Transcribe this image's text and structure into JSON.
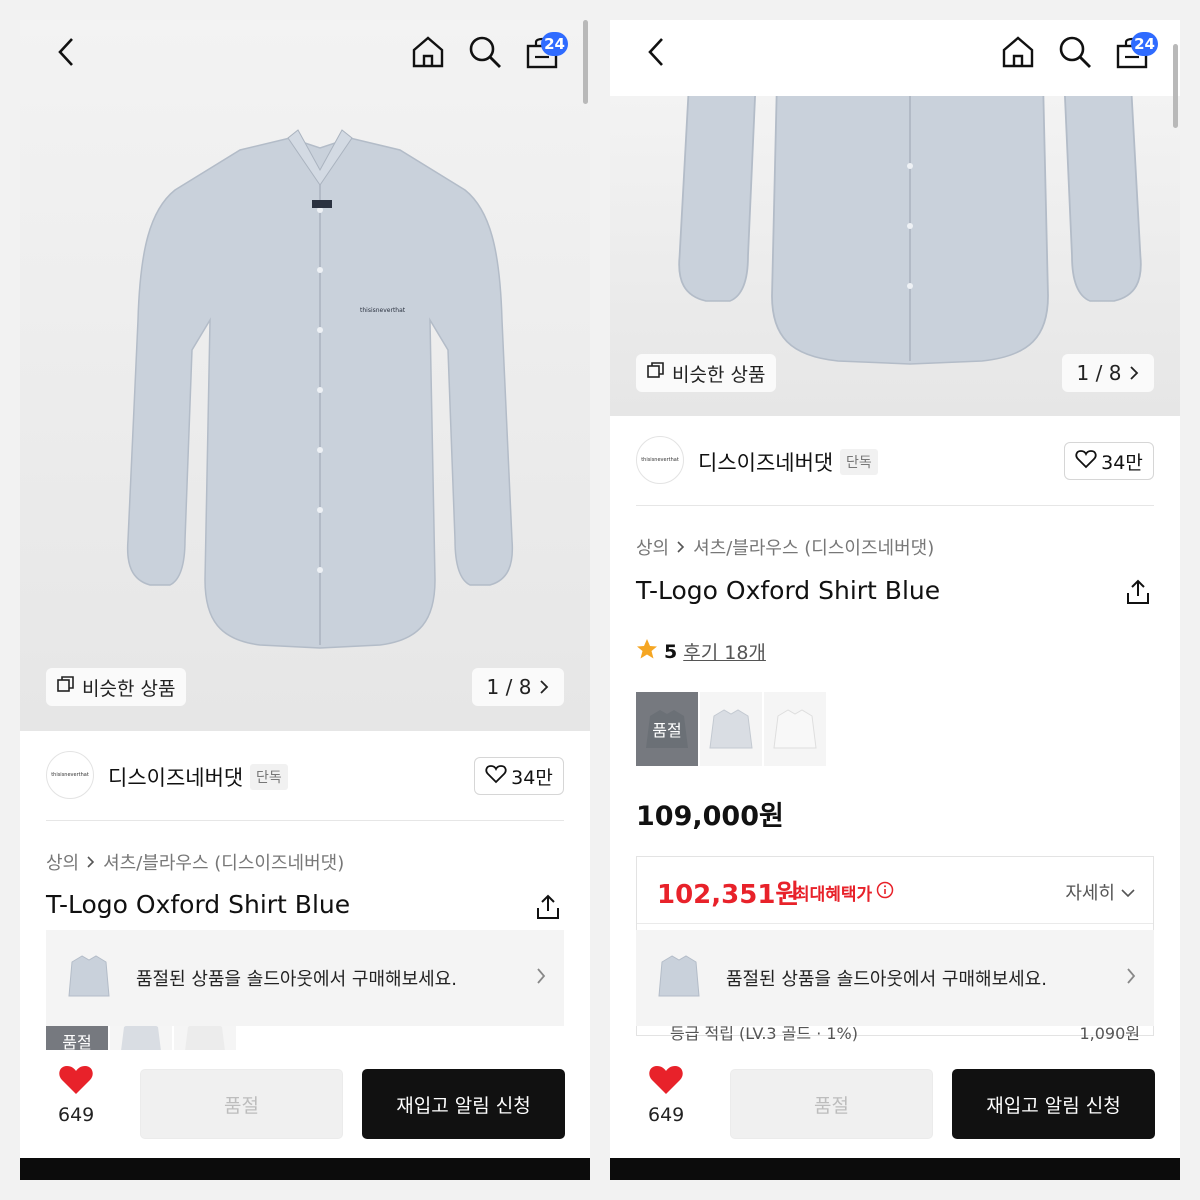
{
  "header": {
    "cart_count": "24",
    "icons": [
      "chevron-left-icon",
      "home-icon",
      "search-icon",
      "shopping-bag-icon"
    ]
  },
  "gallery": {
    "similar_label": "비슷한 상품",
    "page_indicator": "1 / 8",
    "shirt_logo_text": "thisisneverthat"
  },
  "brand": {
    "logo_text": "thisisneverthat",
    "name": "디스이즈네버댓",
    "tag": "단독",
    "likes": "34만"
  },
  "breadcrumb": {
    "category": "상의",
    "subcategory": "셔츠/블라우스 (디스이즈네버댓)"
  },
  "product": {
    "title": "T-Logo Oxford Shirt Blue",
    "rating": "5",
    "reviews_label": "후기 18개",
    "price": "109,000원"
  },
  "swatches": {
    "soldout_label": "품절",
    "colors": [
      "#8a9099",
      "#d9dde3",
      "#f6f6f6"
    ]
  },
  "benefit": {
    "price": "102,351원",
    "label": "최대혜택가",
    "details_label": "자세히"
  },
  "soldout_banner": {
    "text": "품절된 상품을 솔드아웃에서 구매해보세요."
  },
  "partial_row": {
    "left": "등급 적립 (LV.3 골드 · 1%)",
    "right": "1,090원"
  },
  "bottom_bar": {
    "like_count": "649",
    "soldout_label": "품절",
    "restock_label": "재입고 알림 신청"
  },
  "colors": {
    "accent_red": "#e8222a",
    "badge_blue": "#2f6bff",
    "heart_red": "#e8222a"
  }
}
